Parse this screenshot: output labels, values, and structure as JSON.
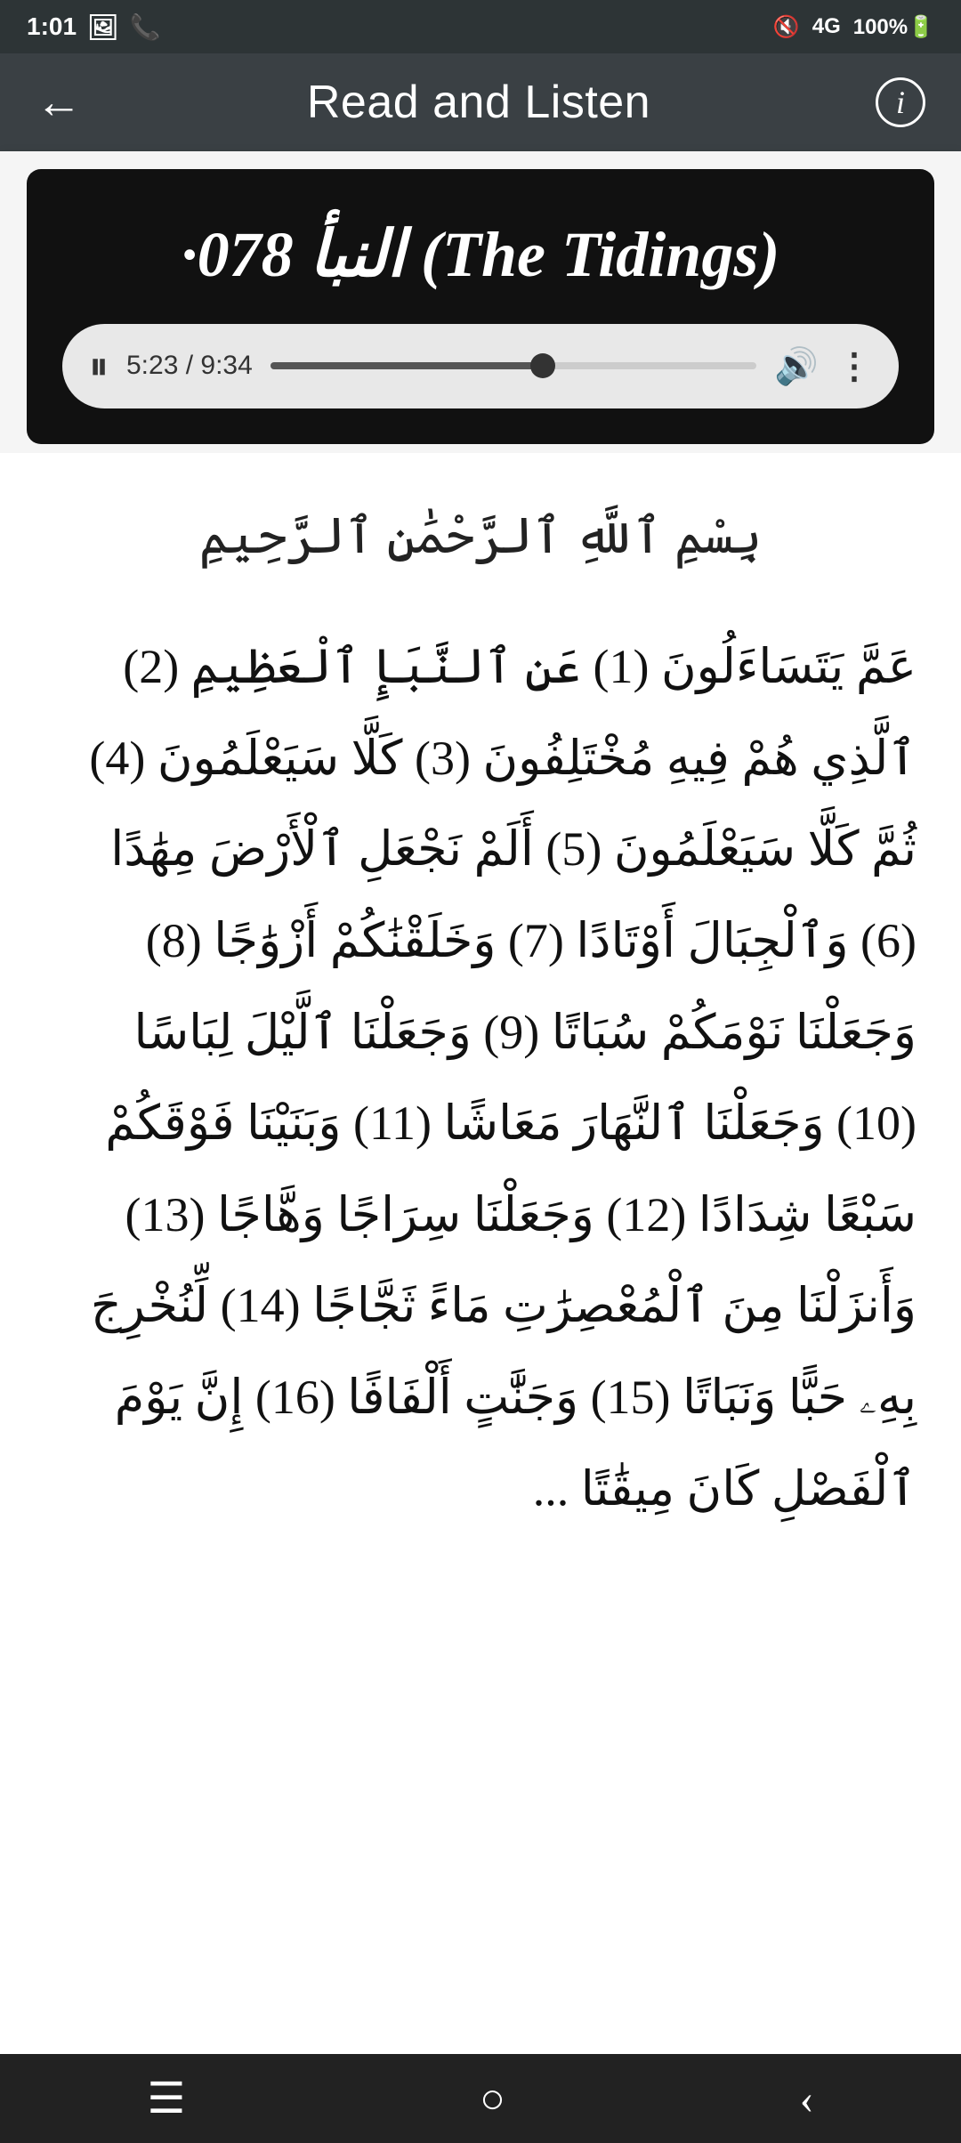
{
  "statusBar": {
    "time": "1:01",
    "icons": [
      "photo",
      "phone",
      "mute",
      "signal-4g",
      "battery-100"
    ]
  },
  "header": {
    "backLabel": "←",
    "title": "Read and Listen",
    "infoLabel": "i"
  },
  "mediaPlayer": {
    "surahTitle": "·078 النبأ (The\nTidings)",
    "timeDisplay": "5:23 / 9:34",
    "progressPercent": 56
  },
  "content": {
    "bismillah": "بِسْمِ ٱللَّهِ ٱلرَّحْمَٰنِ ٱلرَّحِيمِ",
    "quranText": "عَمَّ يَتَسَاءَلُونَ (1) عَنِ ٱلنَّبَإِ ٱلْعَظِيمِ (2) ٱلَّذِي هُمْ فِيهِ مُخْتَلِفُونَ (3) كَلَّا سَيَعْلَمُونَ (4) ثُمَّ كَلَّا سَيَعْلَمُونَ (5) أَلَمْ نَجْعَلِ ٱلْأَرْضَ مِهَٰدًا (6) وَٱلْجِبَالَ أَوْتَادًا (7) وَخَلَقْنَٰكُمْ أَزْوَٰجًا (8) وَجَعَلْنَا نَوْمَكُمْ سُبَاتًا (9) وَجَعَلْنَا ٱلَّيْلَ لِبَاسًا (10) وَجَعَلْنَا ٱلنَّهَارَ مَعَاشًا (11) وَبَنَيْنَا فَوْقَكُمْ سَبْعًا شِدَادًا (12) وَجَعَلْنَا سِرَاجًا وَهَّاجًا (13) وَأَنزَلْنَا مِنَ ٱلْمُعْصِرَٰتِ مَاءً ثَجَّاجًا (14) لِّنُخْرِجَ بِهِۦ حَبًّا وَنَبَاتًا (15) وَجَنَّٰتٍ أَلْفَافًا (16) إِنَّ يَوْمَ ٱلْفَصْلِ كَانَ مِيقَٰتًا ..."
  },
  "bottomNav": {
    "menuIcon": "☰",
    "homeIcon": "○",
    "backIcon": "‹"
  }
}
